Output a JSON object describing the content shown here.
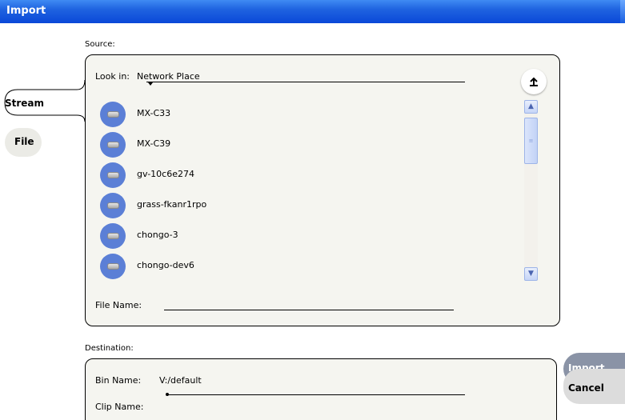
{
  "window": {
    "title": "Import"
  },
  "tabs": [
    {
      "label": "Stream",
      "active": true
    },
    {
      "label": "File",
      "active": false
    }
  ],
  "source": {
    "label": "Source:",
    "look_in_label": "Look in:",
    "look_in_value": "Network Place",
    "up_icon": "up-arrow-icon",
    "items": [
      {
        "label": "MX-C33",
        "icon": "network-drive-icon"
      },
      {
        "label": "MX-C39",
        "icon": "network-drive-icon"
      },
      {
        "label": "gv-10c6e274",
        "icon": "network-drive-icon"
      },
      {
        "label": "grass-fkanr1rpo",
        "icon": "network-drive-icon"
      },
      {
        "label": "chongo-3",
        "icon": "network-drive-icon"
      },
      {
        "label": "chongo-dev6",
        "icon": "network-drive-icon"
      }
    ],
    "file_name_label": "File Name:",
    "file_name_value": ""
  },
  "destination": {
    "label": "Destination:",
    "bin_name_label": "Bin Name:",
    "bin_name_value": "V:/default",
    "clip_name_label": "Clip Name:",
    "clip_name_value": ""
  },
  "actions": {
    "import_label": "Import",
    "cancel_label": "Cancel"
  },
  "colors": {
    "titlebar": "#0a48d8",
    "panel_bg": "#f5f5f0",
    "item_icon_bg": "#5b7fd6",
    "import_btn": "#8a93a6",
    "cancel_btn": "#dcdcdc"
  }
}
